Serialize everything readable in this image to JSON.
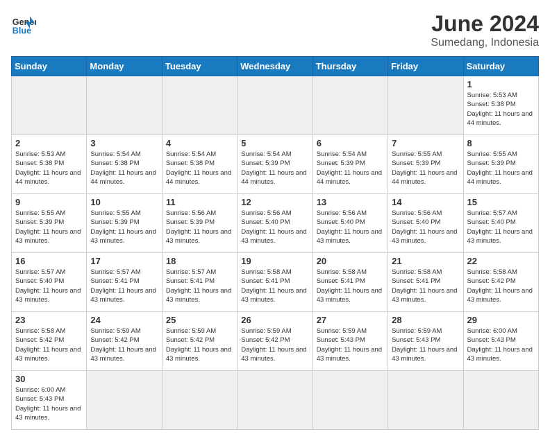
{
  "header": {
    "logo_general": "General",
    "logo_blue": "Blue",
    "title": "June 2024",
    "subtitle": "Sumedang, Indonesia"
  },
  "days_of_week": [
    "Sunday",
    "Monday",
    "Tuesday",
    "Wednesday",
    "Thursday",
    "Friday",
    "Saturday"
  ],
  "weeks": [
    [
      {
        "day": "",
        "empty": true
      },
      {
        "day": "",
        "empty": true
      },
      {
        "day": "",
        "empty": true
      },
      {
        "day": "",
        "empty": true
      },
      {
        "day": "",
        "empty": true
      },
      {
        "day": "",
        "empty": true
      },
      {
        "day": "1",
        "sunrise": "5:53 AM",
        "sunset": "5:38 PM",
        "daylight": "11 hours and 44 minutes."
      }
    ],
    [
      {
        "day": "2",
        "sunrise": "5:53 AM",
        "sunset": "5:38 PM",
        "daylight": "11 hours and 44 minutes."
      },
      {
        "day": "3",
        "sunrise": "5:54 AM",
        "sunset": "5:38 PM",
        "daylight": "11 hours and 44 minutes."
      },
      {
        "day": "4",
        "sunrise": "5:54 AM",
        "sunset": "5:38 PM",
        "daylight": "11 hours and 44 minutes."
      },
      {
        "day": "5",
        "sunrise": "5:54 AM",
        "sunset": "5:39 PM",
        "daylight": "11 hours and 44 minutes."
      },
      {
        "day": "6",
        "sunrise": "5:54 AM",
        "sunset": "5:39 PM",
        "daylight": "11 hours and 44 minutes."
      },
      {
        "day": "7",
        "sunrise": "5:55 AM",
        "sunset": "5:39 PM",
        "daylight": "11 hours and 44 minutes."
      },
      {
        "day": "8",
        "sunrise": "5:55 AM",
        "sunset": "5:39 PM",
        "daylight": "11 hours and 44 minutes."
      }
    ],
    [
      {
        "day": "9",
        "sunrise": "5:55 AM",
        "sunset": "5:39 PM",
        "daylight": "11 hours and 43 minutes."
      },
      {
        "day": "10",
        "sunrise": "5:55 AM",
        "sunset": "5:39 PM",
        "daylight": "11 hours and 43 minutes."
      },
      {
        "day": "11",
        "sunrise": "5:56 AM",
        "sunset": "5:39 PM",
        "daylight": "11 hours and 43 minutes."
      },
      {
        "day": "12",
        "sunrise": "5:56 AM",
        "sunset": "5:40 PM",
        "daylight": "11 hours and 43 minutes."
      },
      {
        "day": "13",
        "sunrise": "5:56 AM",
        "sunset": "5:40 PM",
        "daylight": "11 hours and 43 minutes."
      },
      {
        "day": "14",
        "sunrise": "5:56 AM",
        "sunset": "5:40 PM",
        "daylight": "11 hours and 43 minutes."
      },
      {
        "day": "15",
        "sunrise": "5:57 AM",
        "sunset": "5:40 PM",
        "daylight": "11 hours and 43 minutes."
      }
    ],
    [
      {
        "day": "16",
        "sunrise": "5:57 AM",
        "sunset": "5:40 PM",
        "daylight": "11 hours and 43 minutes."
      },
      {
        "day": "17",
        "sunrise": "5:57 AM",
        "sunset": "5:41 PM",
        "daylight": "11 hours and 43 minutes."
      },
      {
        "day": "18",
        "sunrise": "5:57 AM",
        "sunset": "5:41 PM",
        "daylight": "11 hours and 43 minutes."
      },
      {
        "day": "19",
        "sunrise": "5:58 AM",
        "sunset": "5:41 PM",
        "daylight": "11 hours and 43 minutes."
      },
      {
        "day": "20",
        "sunrise": "5:58 AM",
        "sunset": "5:41 PM",
        "daylight": "11 hours and 43 minutes."
      },
      {
        "day": "21",
        "sunrise": "5:58 AM",
        "sunset": "5:41 PM",
        "daylight": "11 hours and 43 minutes."
      },
      {
        "day": "22",
        "sunrise": "5:58 AM",
        "sunset": "5:42 PM",
        "daylight": "11 hours and 43 minutes."
      }
    ],
    [
      {
        "day": "23",
        "sunrise": "5:58 AM",
        "sunset": "5:42 PM",
        "daylight": "11 hours and 43 minutes."
      },
      {
        "day": "24",
        "sunrise": "5:59 AM",
        "sunset": "5:42 PM",
        "daylight": "11 hours and 43 minutes."
      },
      {
        "day": "25",
        "sunrise": "5:59 AM",
        "sunset": "5:42 PM",
        "daylight": "11 hours and 43 minutes."
      },
      {
        "day": "26",
        "sunrise": "5:59 AM",
        "sunset": "5:42 PM",
        "daylight": "11 hours and 43 minutes."
      },
      {
        "day": "27",
        "sunrise": "5:59 AM",
        "sunset": "5:43 PM",
        "daylight": "11 hours and 43 minutes."
      },
      {
        "day": "28",
        "sunrise": "5:59 AM",
        "sunset": "5:43 PM",
        "daylight": "11 hours and 43 minutes."
      },
      {
        "day": "29",
        "sunrise": "6:00 AM",
        "sunset": "5:43 PM",
        "daylight": "11 hours and 43 minutes."
      }
    ],
    [
      {
        "day": "30",
        "sunrise": "6:00 AM",
        "sunset": "5:43 PM",
        "daylight": "11 hours and 43 minutes."
      },
      {
        "day": "",
        "empty": true
      },
      {
        "day": "",
        "empty": true
      },
      {
        "day": "",
        "empty": true
      },
      {
        "day": "",
        "empty": true
      },
      {
        "day": "",
        "empty": true
      },
      {
        "day": "",
        "empty": true
      }
    ]
  ],
  "labels": {
    "sunrise": "Sunrise:",
    "sunset": "Sunset:",
    "daylight": "Daylight:"
  }
}
